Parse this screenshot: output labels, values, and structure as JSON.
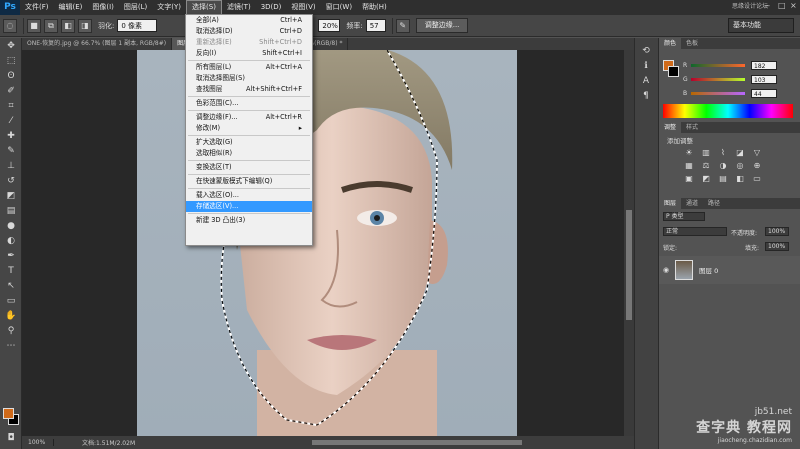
{
  "app": {
    "logo": "Ps",
    "title": "思缘设计论坛"
  },
  "menubar": {
    "items": [
      "文件(F)",
      "编辑(E)",
      "图像(I)",
      "图层(L)",
      "文字(Y)",
      "选择(S)",
      "滤镜(T)",
      "3D(D)",
      "视图(V)",
      "窗口(W)",
      "帮助(H)"
    ],
    "active": "选择(S)"
  },
  "options": {
    "feather_label": "羽化:",
    "feather_value": "0 像素",
    "width_value": "20%",
    "frequency_label": "频率:",
    "frequency_value": "57",
    "refine_button": "调整边缘...",
    "workspace": "基本功能"
  },
  "tabs": [
    "ONE-恢复的.jpg @ 66.7% (图层 1 副本, RGB/8#)",
    "图层 0, RGB/8#) *",
    "虎人 恢复的.psd @ 66.7%(RGB/8) *"
  ],
  "menu": {
    "items": [
      {
        "label": "全部(A)",
        "shortcut": "Ctrl+A",
        "state": "normal"
      },
      {
        "label": "取消选择(D)",
        "shortcut": "Ctrl+D",
        "state": "normal"
      },
      {
        "label": "重新选择(E)",
        "shortcut": "Shift+Ctrl+D",
        "state": "disabled"
      },
      {
        "label": "反向(I)",
        "shortcut": "Shift+Ctrl+I",
        "state": "normal"
      },
      {
        "sep": true
      },
      {
        "label": "所有图层(L)",
        "shortcut": "Alt+Ctrl+A",
        "state": "normal"
      },
      {
        "label": "取消选择图层(S)",
        "shortcut": "",
        "state": "normal"
      },
      {
        "label": "查找图层",
        "shortcut": "Alt+Shift+Ctrl+F",
        "state": "normal"
      },
      {
        "sep": true
      },
      {
        "label": "色彩范围(C)...",
        "shortcut": "",
        "state": "normal"
      },
      {
        "sep": true
      },
      {
        "label": "调整边缘(F)...",
        "shortcut": "Alt+Ctrl+R",
        "state": "normal"
      },
      {
        "label": "修改(M)",
        "shortcut": "▸",
        "state": "normal"
      },
      {
        "sep": true
      },
      {
        "label": "扩大选取(G)",
        "shortcut": "",
        "state": "normal"
      },
      {
        "label": "选取相似(R)",
        "shortcut": "",
        "state": "normal"
      },
      {
        "sep": true
      },
      {
        "label": "变换选区(T)",
        "shortcut": "",
        "state": "normal"
      },
      {
        "sep": true
      },
      {
        "label": "在快速蒙版模式下编辑(Q)",
        "shortcut": "",
        "state": "normal"
      },
      {
        "sep": true
      },
      {
        "label": "载入选区(O)...",
        "shortcut": "",
        "state": "normal"
      },
      {
        "label": "存储选区(V)...",
        "shortcut": "",
        "state": "highlighted"
      },
      {
        "sep": true
      },
      {
        "label": "新建 3D 凸出(3)",
        "shortcut": "",
        "state": "normal"
      }
    ]
  },
  "color_panel": {
    "tabs": [
      "颜色",
      "色板"
    ],
    "r": "182",
    "g": "103",
    "b": "44",
    "labels": [
      "R",
      "G",
      "B"
    ]
  },
  "adjust_panel": {
    "tabs": [
      "调整",
      "样式"
    ],
    "title": "添加调整"
  },
  "layers_panel": {
    "tabs": [
      "图层",
      "通道",
      "路径"
    ],
    "filter": "P 类型",
    "blend_mode": "正常",
    "opacity_label": "不透明度:",
    "opacity": "100%",
    "lock_label": "锁定:",
    "fill_label": "填充:",
    "fill": "100%",
    "layer_name": "图层 0"
  },
  "status": {
    "zoom": "100%",
    "doc": "文档:1.51M/2.02M"
  },
  "watermark": {
    "line1": "jb51.net",
    "line2": "查字典 教程网",
    "line3": "jiaocheng.chazidian.com"
  },
  "colors": {
    "foreground": "#cf6a1a",
    "background": "#000000",
    "menu_highlight": "#3399ff"
  }
}
